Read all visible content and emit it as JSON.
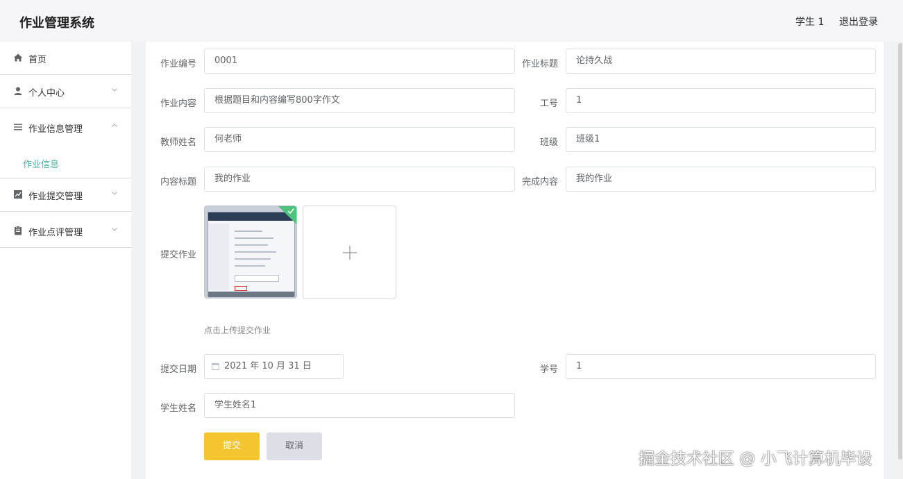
{
  "header": {
    "title": "作业管理系统",
    "user": "学生 1",
    "logout": "退出登录"
  },
  "sidebar": {
    "items": [
      {
        "label": "首页",
        "icon": "home-icon"
      },
      {
        "label": "个人中心",
        "icon": "user-icon"
      },
      {
        "label": "作业信息管理",
        "icon": "list-icon"
      },
      {
        "label": "作业信息",
        "icon": ""
      },
      {
        "label": "作业提交管理",
        "icon": "chart-icon"
      },
      {
        "label": "作业点评管理",
        "icon": "clipboard-icon"
      }
    ],
    "active_color": "#48b0a0"
  },
  "form": {
    "hw_no_label": "作业编号",
    "hw_no_value": "0001",
    "hw_title_label": "作业标题",
    "hw_title_value": "论持久战",
    "hw_content_label": "作业内容",
    "hw_content_value": "根据题目和内容编写800字作文",
    "staff_no_label": "工号",
    "staff_no_value": "1",
    "teacher_label": "教师姓名",
    "teacher_value": "何老师",
    "class_label": "班级",
    "class_value": "班级1",
    "content_title_label": "内容标题",
    "content_title_value": "我的作业",
    "done_content_label": "完成内容",
    "done_content_value": "我的作业",
    "submit_hw_label": "提交作业",
    "upload_hint": "点击上传提交作业",
    "submit_date_label": "提交日期",
    "submit_date_value": "2021 年 10 月 31 日",
    "student_no_label": "学号",
    "student_no_value": "1",
    "student_name_label": "学生姓名",
    "student_name_value": "学生姓名1",
    "submit_button": "提交",
    "cancel_button": "取消",
    "submit_color": "#f5c52f"
  },
  "watermark": "掘金技术社区 @ 小飞计算机毕设"
}
